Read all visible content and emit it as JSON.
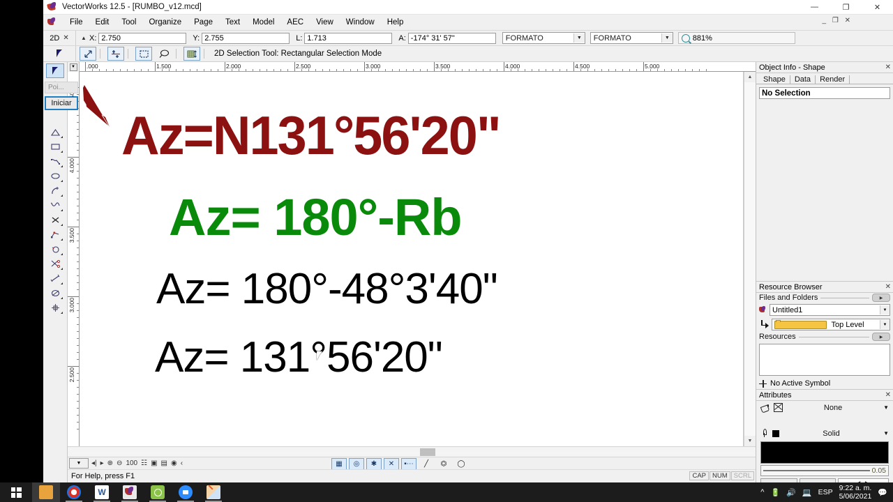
{
  "window": {
    "title": "VectorWorks 12.5 - [RUMBO_v12.mcd]",
    "minimize": "—",
    "maximize": "❐",
    "close": "✕",
    "doc_minimize": "_",
    "doc_restore": "❐",
    "doc_close": "✕"
  },
  "menu": [
    {
      "label": "File"
    },
    {
      "label": "Edit"
    },
    {
      "label": "Tool"
    },
    {
      "label": "Organize"
    },
    {
      "label": "Page"
    },
    {
      "label": "Text"
    },
    {
      "label": "Model"
    },
    {
      "label": "AEC"
    },
    {
      "label": "View"
    },
    {
      "label": "Window"
    },
    {
      "label": "Help"
    }
  ],
  "coordbar": {
    "mode_label": "2D",
    "mode_close": "✕",
    "x_label": "X:",
    "x_value": "2.750",
    "y_label": "Y:",
    "y_value": "2.755",
    "l_label": "L:",
    "l_value": "1.713",
    "a_label": "A:",
    "a_value": "-174° 31' 57\"",
    "format1": "FORMATO",
    "format2": "FORMATO",
    "zoom": "881%"
  },
  "modebar": {
    "status_text": "2D Selection Tool: Rectangular Selection Mode"
  },
  "toolpalette": {
    "popover_label": "Poi...",
    "popover_button": "Iniciar"
  },
  "rulers": {
    "horizontal": [
      ".000",
      "1.500",
      "2.000",
      "2.500",
      "3.000",
      "3.500",
      "4.000",
      "4.500",
      "5.000"
    ],
    "vertical": [
      "4.500",
      "4.000",
      "3.500",
      "3.000",
      "2.500"
    ]
  },
  "canvas": {
    "line1": "Az=N131°56'20\"",
    "line2": "Az= 180°-Rb",
    "line3": "Az= 180°-48°3'40\"",
    "line4": "Az= 131°56'20\"",
    "color_line1": "#8c1111",
    "color_line2": "#0a8a0a",
    "color_line3": "#000000",
    "color_line4": "#000000",
    "arrow_color": "#8c1111"
  },
  "bottombar": {
    "zoom_percent": "100"
  },
  "statusbar": {
    "help_text": "For Help, press F1",
    "cap": "CAP",
    "num": "NUM",
    "scrl": "SCRL"
  },
  "object_info": {
    "title": "Object Info - Shape",
    "close": "✕",
    "tabs": [
      "Shape",
      "Data",
      "Render"
    ],
    "selection": "No Selection"
  },
  "resource_browser": {
    "title": "Resource Browser",
    "close": "✕",
    "files_label": "Files and Folders",
    "file_value": "Untitled1",
    "folder_value": "Top Level",
    "resources_label": "Resources",
    "active_symbol": "No Active Symbol"
  },
  "attributes": {
    "title": "Attributes",
    "close": "✕",
    "fill_value": "None",
    "pen_value": "Solid",
    "line_weight": "0.05",
    "nav_arrows": "◀ ▶"
  },
  "taskbar": {
    "language": "ESP",
    "time": "9:22 a. m.",
    "date": "5/06/2021"
  }
}
